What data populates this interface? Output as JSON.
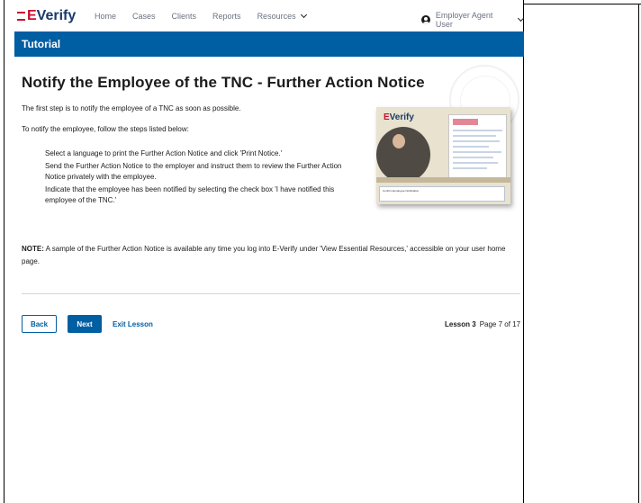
{
  "nav": {
    "logo_e": "E",
    "logo_verify": "Verify",
    "links": [
      "Home",
      "Cases",
      "Clients",
      "Reports",
      "Resources"
    ],
    "user": "Employer Agent User"
  },
  "banner": {
    "title": "Tutorial"
  },
  "main": {
    "heading": "Notify the Employee of the TNC - Further Action Notice",
    "intro1": "The first step is to notify the employee of a TNC as soon as possible.",
    "intro2": "To notify the employee, follow the steps listed below:",
    "steps": [
      "Select a language to print the Further Action Notice and click 'Print Notice.'",
      "Send the Further Action Notice to the employer and instruct them to review the Further Action Notice privately with the employee.",
      "Indicate that the employee has been notified by selecting the check box 'I have notified this employee of the TNC.'"
    ],
    "note_label": "NOTE:",
    "note_text": " A sample of the Further Action Notice is available any time you log into E-Verify under 'View Essential Resources,' accessible on your user home page."
  },
  "illustration": {
    "logo_e": "E",
    "logo_verify": "Verify",
    "box_text": "Confirm Employee Notification"
  },
  "footer": {
    "back_label": "Back",
    "next_label": "Next",
    "exit_label": "Exit Lesson",
    "lesson_label": "Lesson 3",
    "page_label": "Page 7 of 17"
  },
  "colors": {
    "primary": "#005ea2",
    "brand_red": "#c8102e",
    "brand_navy": "#1a3a6b"
  }
}
